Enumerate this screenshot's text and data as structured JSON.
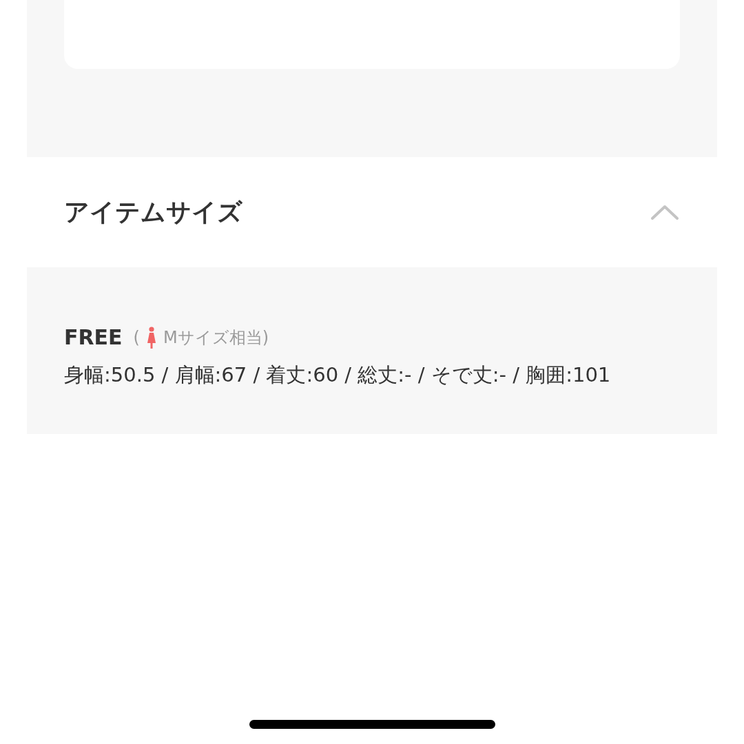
{
  "section": {
    "title": "アイテムサイズ",
    "expanded": true
  },
  "sizes": [
    {
      "label": "FREE",
      "open_paren": "(",
      "equivalent": "Mサイズ相当)",
      "measurements": "身幅:50.5 / 肩幅:67 / 着丈:60 / 総丈:- / そで丈:- / 胸囲:101"
    }
  ]
}
